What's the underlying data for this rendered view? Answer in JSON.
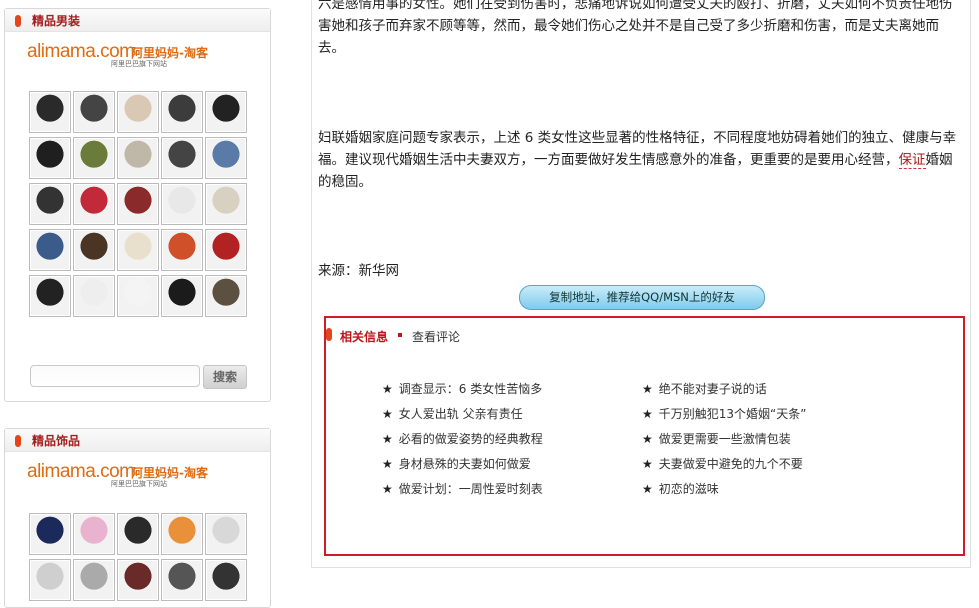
{
  "left_panels": [
    {
      "title": "精品男装",
      "logo": {
        "main": "alimama.com",
        "cn": "阿里妈妈-淘客",
        "sub": "阿里巴巴旗下网站"
      },
      "thumbs": [
        "#2a2a2a",
        "#444",
        "#d9c9b4",
        "#3c3c3c",
        "#222",
        "#1f1f1f",
        "#6b7b3a",
        "#bfb7a8",
        "#444",
        "#5a7aa8",
        "#333",
        "#c22a3a",
        "#8a2a2a",
        "#e8e8e8",
        "#d8d0c0",
        "#3b5b8b",
        "#4a3424",
        "#e8e0cc",
        "#d0502a",
        "#b22222",
        "#222",
        "#eeeeee",
        "#f4f4f4",
        "#1b1b1b",
        "#5c5040"
      ],
      "search_button": "搜索"
    },
    {
      "title": "精品饰品",
      "logo": {
        "main": "alimama.com",
        "cn": "阿里妈妈-淘客",
        "sub": "阿里巴巴旗下网站"
      },
      "thumbs": [
        "#1b2a5a",
        "#e9b3d0",
        "#2a2a2a",
        "#e8903a",
        "#d8d8d8",
        "#cfcfcf",
        "#aaaaaa",
        "#6a2a2a",
        "#555",
        "#333"
      ]
    }
  ],
  "article": {
    "paragraph1": "六是感情用事的女性。她们在受到伤害时，悲痛地诉说如何遭受丈夫的殴打、折磨，丈夫如何不负责任地伤害她和孩子而弃家不顾等等，然而，最令她们伤心之处并不是自己受了多少折磨和伤害，而是丈夫离她而去。",
    "paragraph2_before": "妇联婚姻家庭问题专家表示，上述 6 类女性这些显著的性格特征，不同程度地妨碍着她们的独立、健康与幸福。建议现代婚姻生活中夫妻双方，一方面要做好发生情感意外的准备，更重要的是要用心经营，",
    "paragraph2_link": "保证",
    "paragraph2_after": "婚姻的稳固。",
    "source": "来源：新华网",
    "copy_button": "复制地址，推荐给QQ/MSN上的好友"
  },
  "related": {
    "title": "相关信息",
    "comments": "查看评论",
    "left_items": [
      "调查显示：6 类女性苦恼多",
      "女人爱出轨 父亲有责任",
      "必看的做爱姿势的经典教程",
      "身材悬殊的夫妻如何做爱",
      "做爱计划：一周性爱时刻表"
    ],
    "right_items": [
      "绝不能对妻子说的话",
      "千万别触犯13个婚姻“天条”",
      "做爱更需要一些激情包装",
      "夫妻做爱中避免的九个不要",
      "初恋的滋味"
    ]
  }
}
